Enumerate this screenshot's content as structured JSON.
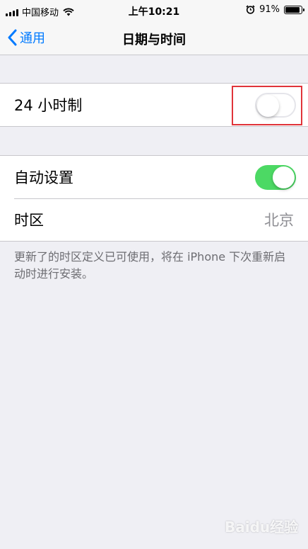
{
  "status_bar": {
    "carrier": "中国移动",
    "time": "上午10:21",
    "battery": "91%",
    "battery_level": 0.91
  },
  "nav": {
    "back_label": "通用",
    "title": "日期与时间"
  },
  "settings": {
    "hour24": {
      "label": "24 小时制",
      "enabled": false
    },
    "auto_set": {
      "label": "自动设置",
      "enabled": true
    },
    "timezone": {
      "label": "时区",
      "value": "北京"
    }
  },
  "footer_note": "更新了的时区定义已可使用，将在 iPhone 下次重新启动时进行安装。",
  "watermark": "Baidu经验",
  "colors": {
    "accent": "#007aff",
    "toggle_on": "#4cd964",
    "highlight": "#e0343a"
  }
}
